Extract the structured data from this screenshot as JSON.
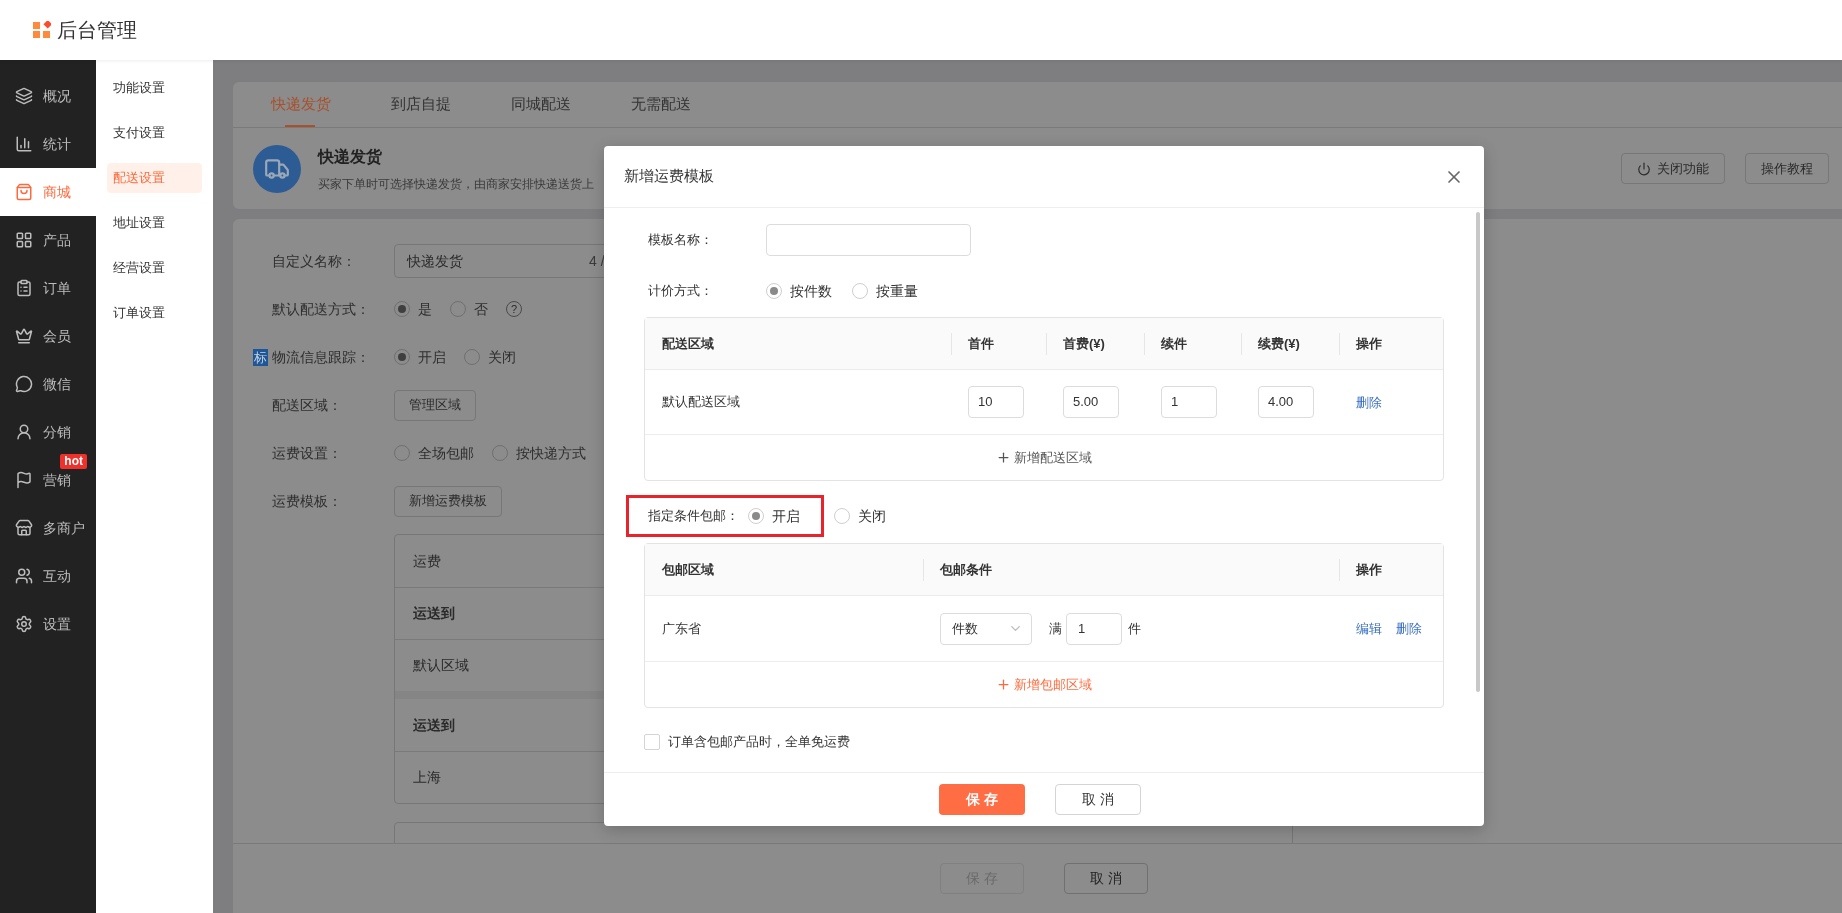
{
  "header": {
    "title": "后台管理"
  },
  "nav": [
    {
      "label": "概况",
      "selected": false
    },
    {
      "label": "统计",
      "selected": false
    },
    {
      "label": "商城",
      "selected": true
    },
    {
      "label": "产品",
      "selected": false
    },
    {
      "label": "订单",
      "selected": false
    },
    {
      "label": "会员",
      "selected": false
    },
    {
      "label": "微信",
      "selected": false
    },
    {
      "label": "分销",
      "selected": false
    },
    {
      "label": "营销",
      "selected": false,
      "badge": "hot"
    },
    {
      "label": "多商户",
      "selected": false
    },
    {
      "label": "互动",
      "selected": false
    },
    {
      "label": "设置",
      "selected": false
    }
  ],
  "subnav": [
    {
      "label": "功能设置",
      "selected": false
    },
    {
      "label": "支付设置",
      "selected": false
    },
    {
      "label": "配送设置",
      "selected": true
    },
    {
      "label": "地址设置",
      "selected": false
    },
    {
      "label": "经营设置",
      "selected": false
    },
    {
      "label": "订单设置",
      "selected": false
    }
  ],
  "tabs": [
    {
      "label": "快递发货",
      "selected": true
    },
    {
      "label": "到店自提",
      "selected": false
    },
    {
      "label": "同城配送",
      "selected": false
    },
    {
      "label": "无需配送",
      "selected": false
    }
  ],
  "feature": {
    "title": "快递发货",
    "description": "买家下单时可选择快递发货，由商家安排快递送货上",
    "buttons": [
      {
        "label": "关闭功能",
        "kind": "power"
      },
      {
        "label": "操作教程",
        "kind": "plain"
      }
    ]
  },
  "form": [
    {
      "kind": "text",
      "label": "自定义名称：",
      "value": "快递发货",
      "counter": "4 /"
    },
    {
      "kind": "radio",
      "label": "默认配送方式：",
      "options": [
        {
          "label": "是",
          "selected": true
        },
        {
          "label": "否",
          "selected": false
        }
      ],
      "help": "?"
    },
    {
      "kind": "radio",
      "label": "物流信息跟踪：",
      "tag": "标",
      "options": [
        {
          "label": "开启",
          "selected": true
        },
        {
          "label": "关闭",
          "selected": false
        }
      ]
    },
    {
      "kind": "button",
      "label": "配送区域：",
      "button": "管理区域"
    },
    {
      "kind": "radio",
      "label": "运费设置：",
      "options": [
        {
          "label": "全场包邮",
          "selected": false
        },
        {
          "label": "按快递方式",
          "selected": false
        }
      ]
    },
    {
      "kind": "button",
      "label": "运费模板：",
      "button": "新增运费模板"
    }
  ],
  "template_groups": [
    {
      "rows": [
        {
          "text": "运费",
          "bold": false
        },
        {
          "text": "运送到",
          "bold": true
        },
        {
          "text": "默认区域",
          "bold": false
        }
      ]
    },
    {
      "rows": [
        {
          "text": "运送到",
          "bold": true
        },
        {
          "text": "上海",
          "bold": false
        }
      ]
    }
  ],
  "footer": {
    "buttons": [
      {
        "label": "保 存",
        "disabled": true
      },
      {
        "label": "取 消",
        "disabled": false
      }
    ]
  },
  "dialog": {
    "title": "新增运费模板",
    "name_field": {
      "label": "模板名称："
    },
    "pricing": {
      "label": "计价方式：",
      "options": [
        {
          "label": "按件数",
          "selected": true
        },
        {
          "label": "按重量",
          "selected": false
        }
      ]
    },
    "region_table": {
      "columns": [
        "配送区域",
        "首件",
        "首费(¥)",
        "续件",
        "续费(¥)",
        "操作"
      ],
      "rows": [
        {
          "region": "默认配送区域",
          "values": [
            "10",
            "5.00",
            "1",
            "4.00"
          ],
          "action": "删除"
        }
      ],
      "add": "新增配送区域"
    },
    "free_shipping": {
      "label": "指定条件包邮：",
      "highlighted": true,
      "options": [
        {
          "label": "开启",
          "selected": true
        },
        {
          "label": "关闭",
          "selected": false
        }
      ]
    },
    "free_table": {
      "columns": [
        "包邮区域",
        "包邮条件",
        "操作"
      ],
      "rows": [
        {
          "region": "广东省",
          "condition": "件数",
          "prefix": "满",
          "amount": "1",
          "unit": "件",
          "actions": [
            "编辑",
            "删除"
          ]
        }
      ],
      "add": "新增包邮区域"
    },
    "whole_order": {
      "label": "订单含包邮产品时，全单免运费",
      "checked": false
    },
    "buttons": [
      {
        "label": "保 存",
        "kind": "primary"
      },
      {
        "label": "取 消",
        "kind": "default"
      }
    ]
  }
}
